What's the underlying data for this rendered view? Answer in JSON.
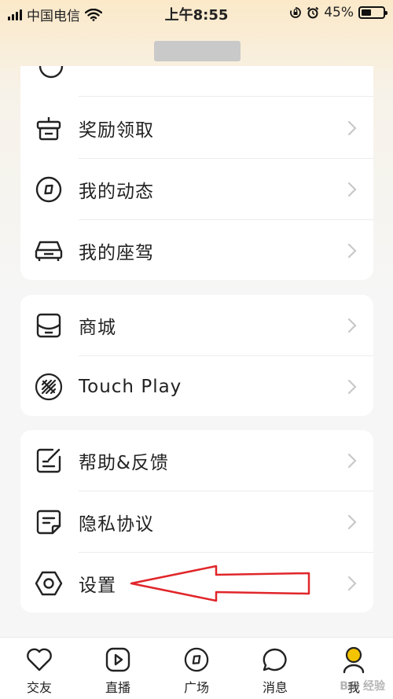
{
  "status_bar": {
    "carrier": "中国电信",
    "time": "上午8:55",
    "battery_percent": "45%",
    "battery_level": 0.45,
    "icons": [
      "signal-icon",
      "wifi-icon",
      "rotation-lock-icon",
      "alarm-icon",
      "battery-icon"
    ]
  },
  "menu": {
    "group1": [
      {
        "label": "奖励领取",
        "icon": "gift-icon"
      },
      {
        "label": "我的动态",
        "icon": "compass-icon"
      },
      {
        "label": "我的座驾",
        "icon": "car-icon"
      }
    ],
    "group2": [
      {
        "label": "商城",
        "icon": "shop-icon"
      },
      {
        "label": "Touch Play",
        "icon": "touch-play-icon"
      }
    ],
    "group3": [
      {
        "label": "帮助&反馈",
        "icon": "feedback-icon"
      },
      {
        "label": "隐私协议",
        "icon": "document-icon"
      },
      {
        "label": "设置",
        "icon": "hexagon-settings-icon"
      }
    ]
  },
  "tabbar": {
    "tabs": [
      {
        "label": "交友",
        "icon": "heart-icon"
      },
      {
        "label": "直播",
        "icon": "play-icon"
      },
      {
        "label": "广场",
        "icon": "compass-icon"
      },
      {
        "label": "消息",
        "icon": "chat-bubble-icon"
      },
      {
        "label": "我",
        "icon": "person-icon",
        "active": true
      }
    ]
  },
  "annotation": {
    "color": "#e0262a"
  },
  "colors": {
    "accent": "#f5c400",
    "background": "#f6f6f6"
  },
  "watermark": "Bai 经验"
}
